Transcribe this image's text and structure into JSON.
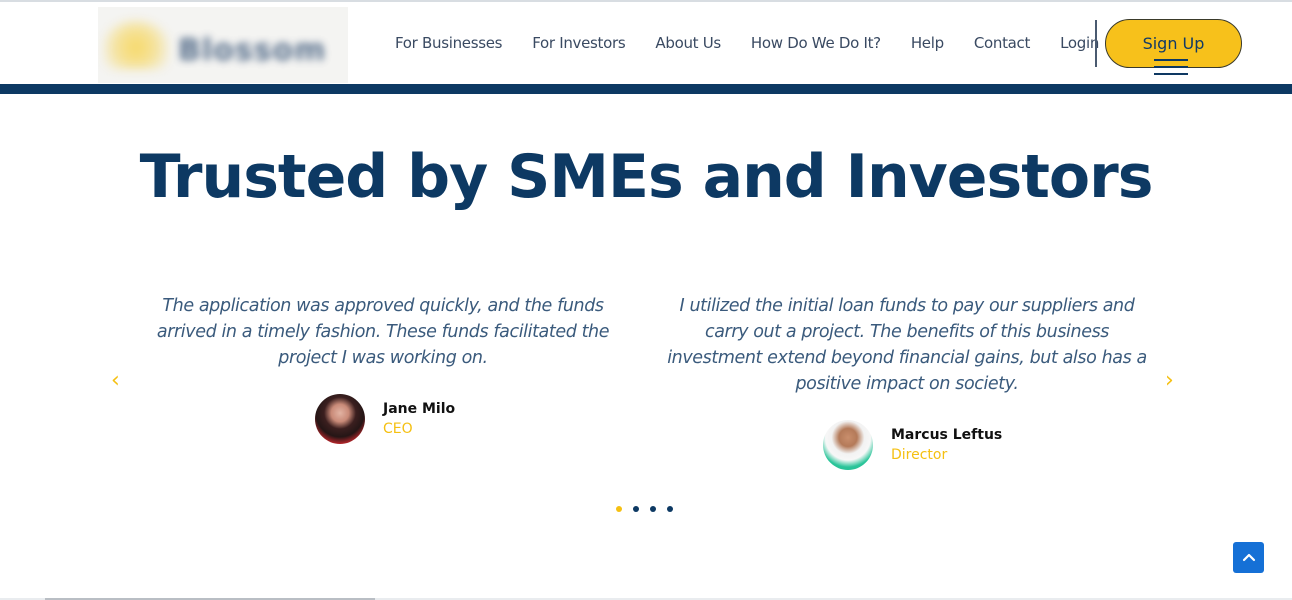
{
  "header": {
    "logo_text": "Blossom",
    "nav": [
      {
        "label": "For Businesses"
      },
      {
        "label": "For Investors"
      },
      {
        "label": "About Us"
      },
      {
        "label": "How Do We Do It?"
      },
      {
        "label": "Help"
      },
      {
        "label": "Contact"
      },
      {
        "label": "Login"
      }
    ],
    "signup_label": "Sign Up"
  },
  "section": {
    "title": "Trusted by SMEs and Investors"
  },
  "testimonials": [
    {
      "quote": "The application was approved quickly, and the funds arrived in a timely fashion. These funds facilitated the project I was working on.",
      "name": "Jane Milo",
      "role": "CEO"
    },
    {
      "quote": "I utilized the initial loan funds to pay our suppliers and carry out a project. The benefits of this business investment extend beyond financial gains, but also has a positive impact on society.",
      "name": "Marcus Leftus",
      "role": "Director"
    }
  ],
  "carousel": {
    "prev_icon": "‹",
    "next_icon": "›",
    "active_dot": 0,
    "dot_count": 4
  },
  "colors": {
    "brand_navy": "#0d3963",
    "accent_yellow": "#f7c11b",
    "scroll_top_blue": "#1570d6"
  }
}
